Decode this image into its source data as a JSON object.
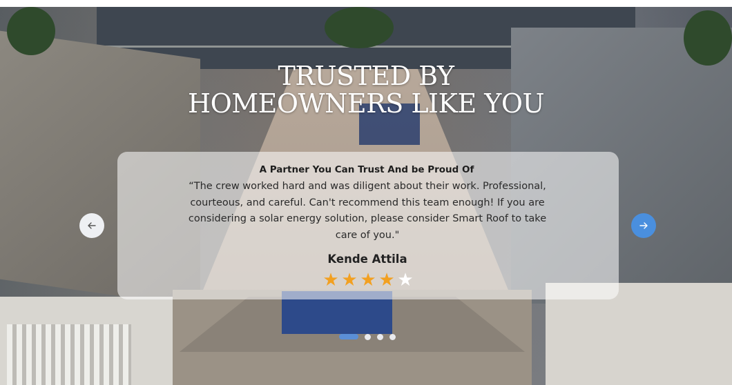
{
  "section": {
    "title_line1": "TRUSTED BY",
    "title_line2": "HOMEOWNERS LIKE YOU"
  },
  "testimonial": {
    "headline": "A Partner You Can Trust And be Proud Of",
    "quote": "“The crew worked hard and was diligent about their work.  Professional, courteous, and careful.  Can't recommend this team enough!  If you are considering a solar energy solution, please consider Smart Roof to take care of you.\"",
    "author": "Kende Attila",
    "rating": 4,
    "rating_max": 5
  },
  "carousel": {
    "prev_icon": "arrow-left-icon",
    "next_icon": "arrow-right-icon",
    "slide_count": 4,
    "active_slide": 1
  },
  "colors": {
    "star_filled": "#f2a021",
    "star_empty": "#ffffff",
    "next_button": "#4a8fde",
    "active_dot": "#5b8fd6"
  }
}
